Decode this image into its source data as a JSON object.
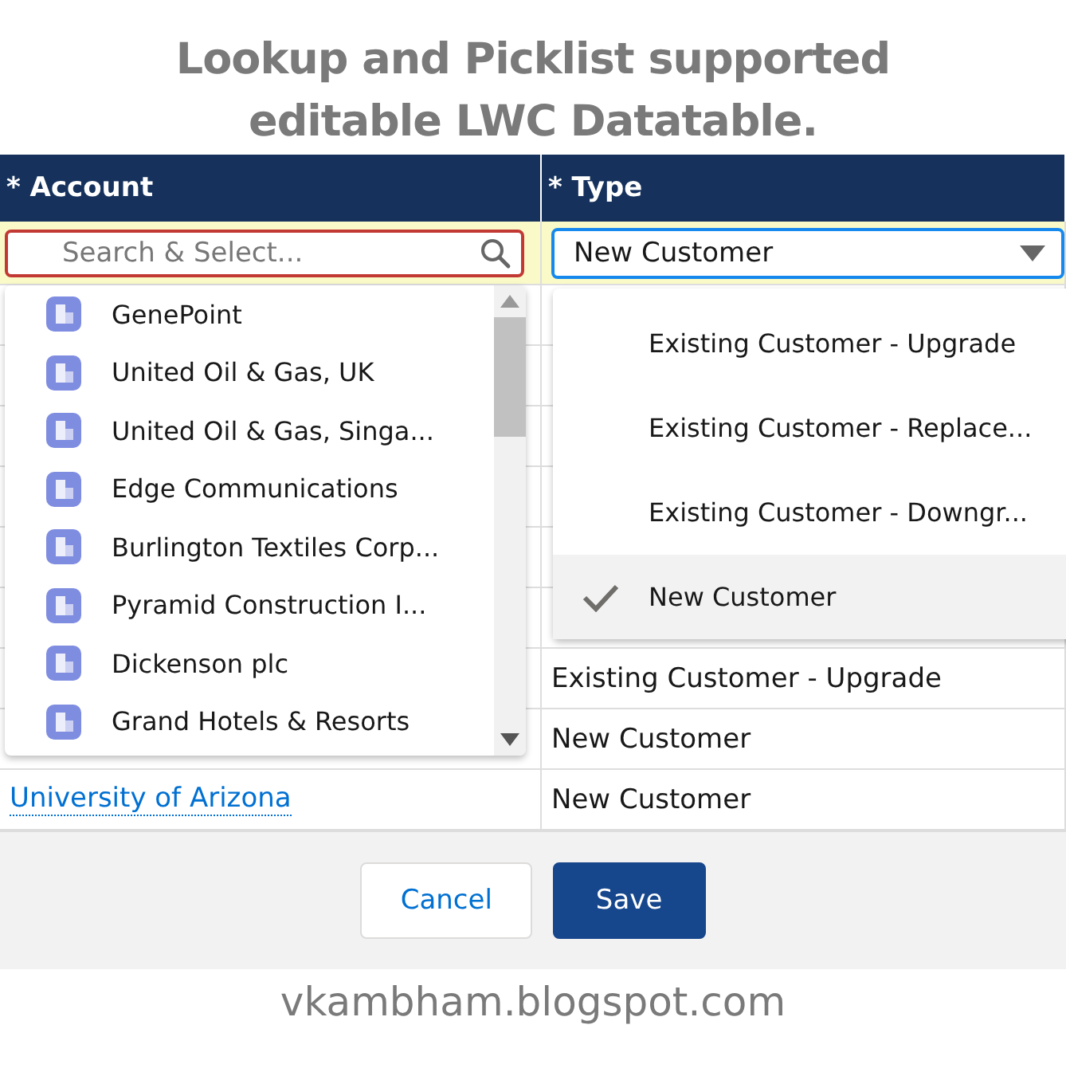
{
  "title": [
    "Lookup and Picklist supported",
    "editable LWC Datatable."
  ],
  "table": {
    "columns": [
      {
        "label": "* Account"
      },
      {
        "label": "* Type"
      }
    ],
    "edit_row": {
      "account_search": {
        "placeholder": "Search & Select..."
      },
      "type_value": "New Customer"
    },
    "rows": [
      {
        "type": "Existing Customer - Upgrade"
      },
      {
        "type": "New Customer"
      },
      {
        "account": "University of Arizona",
        "type": "New Customer"
      }
    ]
  },
  "account_dropdown": {
    "items": [
      "GenePoint",
      "United Oil & Gas, UK",
      "United Oil & Gas, Singa...",
      "Edge Communications",
      "Burlington Textiles Corp...",
      "Pyramid Construction I...",
      "Dickenson plc",
      "Grand Hotels & Resorts"
    ]
  },
  "type_dropdown": {
    "options": [
      {
        "label": "Existing Customer - Upgrade",
        "selected": false
      },
      {
        "label": "Existing Customer - Replace...",
        "selected": false
      },
      {
        "label": "Existing Customer - Downgr...",
        "selected": false
      },
      {
        "label": "New Customer",
        "selected": true
      }
    ]
  },
  "buttons": [
    {
      "label": "Cancel",
      "kind": "neutral"
    },
    {
      "label": "Save",
      "kind": "brand"
    }
  ],
  "footer": "vkambham.blogspot.com"
}
